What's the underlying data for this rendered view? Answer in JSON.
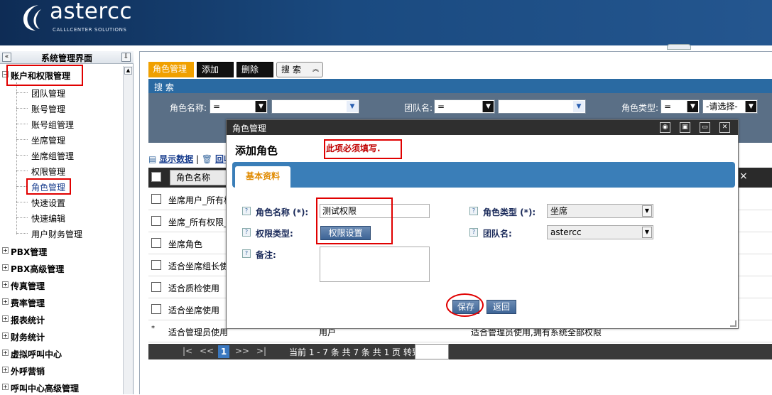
{
  "header": {
    "brand": "astercc",
    "slogan": "CALLLCENTER SOLUTIONS"
  },
  "sidebar": {
    "title": "系统管理界面",
    "groups": [
      {
        "label": "账户和权限管理",
        "expanded": true,
        "children": [
          "团队管理",
          "账号管理",
          "账号组管理",
          "坐席管理",
          "坐席组管理",
          "权限管理",
          "角色管理",
          "快速设置",
          "快速编辑",
          "用户财务管理"
        ]
      },
      {
        "label": "PBX管理"
      },
      {
        "label": "PBX高级管理"
      },
      {
        "label": "传真管理"
      },
      {
        "label": "费率管理"
      },
      {
        "label": "报表统计"
      },
      {
        "label": "财务统计"
      },
      {
        "label": "虚拟呼叫中心"
      },
      {
        "label": "外呼营销"
      },
      {
        "label": "呼叫中心高级管理"
      }
    ],
    "active_child": "角色管理"
  },
  "toolbar": {
    "role_tab": "角色管理",
    "add": "添加",
    "delete": "删除",
    "search": "搜 索"
  },
  "search": {
    "bar_title": "搜 索",
    "role_name_label": "角色名称:",
    "role_name_op": "=",
    "team_label": "团队名:",
    "team_op": "=",
    "role_type_label": "角色类型:",
    "role_type_op": "=",
    "role_type_value": "-请选择-"
  },
  "links": {
    "show_data": "显示数据",
    "sep": "|",
    "recycle": "回收"
  },
  "grid": {
    "col_name": "角色名称",
    "close": "×",
    "rows": [
      {
        "name": "坐席用户_所有权",
        "team": "",
        "desc": ""
      },
      {
        "name": "坐席_所有权限_",
        "team": "",
        "desc": ""
      },
      {
        "name": "坐席角色",
        "team": "",
        "desc": ""
      },
      {
        "name": "适合坐席组长使",
        "team": "",
        "desc": ""
      },
      {
        "name": "适合质检使用",
        "team": "",
        "desc": ""
      },
      {
        "name": "适合坐席使用",
        "team": "",
        "desc": ""
      },
      {
        "name": "适合管理员使用",
        "team": "用户",
        "desc": "适合管理员使用,拥有系统全部权限"
      }
    ],
    "new_row_marker": "*"
  },
  "pager": {
    "first": "|<",
    "prev": "<<",
    "current": "1",
    "next": ">>",
    "last": ">|",
    "info": "当前 1 - 7 条 共 7 条 共 1 页 转到"
  },
  "dialog": {
    "title": "角色管理",
    "heading": "添加角色",
    "required_note": "此项必须填写.",
    "tab": "基本资料",
    "role_name_label": "角色名称 (*):",
    "role_name_value": "测试权限",
    "perm_type_label": "权限类型:",
    "perm_button": "权限设置",
    "note_label": "备注:",
    "role_type_label": "角色类型 (*):",
    "role_type_value": "坐席",
    "team_label": "团队名:",
    "team_value": "astercc",
    "save": "保存",
    "back": "返回"
  },
  "colors": {
    "header_bg": "#1a4a80",
    "accent_orange": "#f0a000",
    "tab_blue": "#3a7eb8",
    "annotation_red": "#e00000"
  }
}
